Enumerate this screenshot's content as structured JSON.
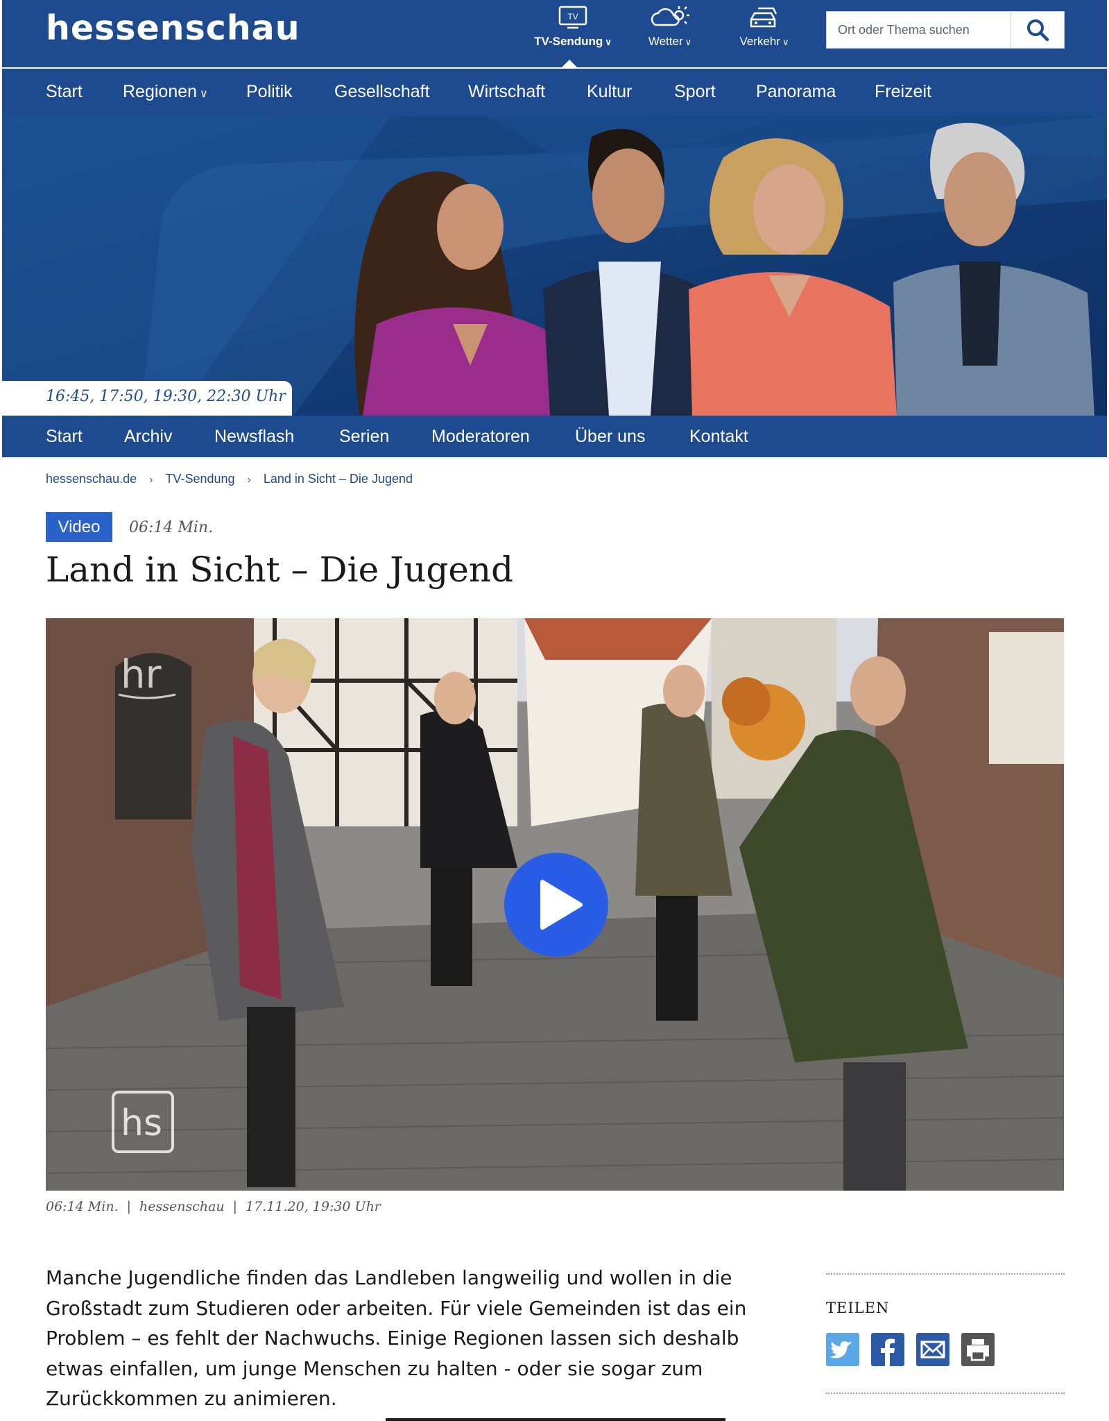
{
  "header": {
    "logo": "hessenschau",
    "services": [
      {
        "label": "TV-Sendung",
        "icon": "tv-icon"
      },
      {
        "label": "Wetter",
        "icon": "weather-icon"
      },
      {
        "label": "Verkehr",
        "icon": "traffic-car-icon"
      }
    ],
    "search": {
      "placeholder": "Ort oder Thema suchen",
      "button_icon": "search-icon"
    }
  },
  "main_nav": {
    "items": [
      "Start",
      "Regionen",
      "Politik",
      "Gesellschaft",
      "Wirtschaft",
      "Kultur",
      "Sport",
      "Panorama",
      "Freizeit"
    ]
  },
  "hero": {
    "airtimes": "16:45, 17:50, 19:30, 22:30 Uhr"
  },
  "sub_nav": {
    "items": [
      "Start",
      "Archiv",
      "Newsflash",
      "Serien",
      "Moderatoren",
      "Über uns",
      "Kontakt"
    ]
  },
  "breadcrumb": {
    "items": [
      "hessenschau.de",
      "TV-Sendung",
      "Land in Sicht – Die Jugend"
    ],
    "separator": "›"
  },
  "article": {
    "badge": "Video",
    "duration": "06:14 Min.",
    "title": "Land in Sicht – Die Jugend",
    "video": {
      "watermark_top": "hr",
      "watermark_bottom": "hs",
      "play_icon": "play-icon"
    },
    "meta": {
      "duration": "06:14 Min.",
      "source": "hessenschau",
      "date": "17.11.20, 19:30 Uhr"
    },
    "body": "Manche Jugendliche finden das Landleben langweilig und wollen in die Großstadt zum Studieren oder arbeiten. Für viele Gemeinden ist das ein Problem – es fehlt der Nachwuchs. Einige Regionen lassen sich deshalb etwas einfallen, um junge Menschen zu halten - oder sie sogar zum Zurückkommen zu animieren."
  },
  "share": {
    "label": "TEILEN",
    "buttons": [
      {
        "icon": "twitter-icon",
        "color": "#5aa7e6"
      },
      {
        "icon": "facebook-icon",
        "color": "#2d5aa6"
      },
      {
        "icon": "mail-icon",
        "color": "#2d5aa6"
      },
      {
        "icon": "print-icon",
        "color": "#555555"
      }
    ]
  },
  "colors": {
    "brand_blue": "#1e4b8f",
    "accent_blue": "#2a62c9",
    "play_blue": "#2a5de6"
  }
}
